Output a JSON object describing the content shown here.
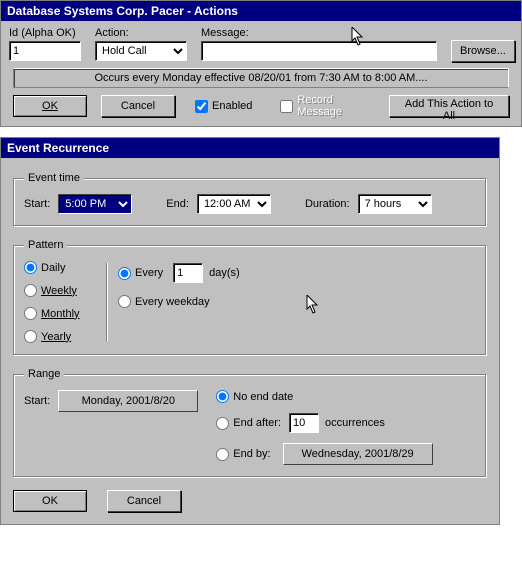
{
  "actions": {
    "title": "Database Systems Corp. Pacer - Actions",
    "labels": {
      "id": "Id (Alpha OK)",
      "action": "Action:",
      "message": "Message:"
    },
    "id_value": "1",
    "action_options": [
      "Hold Call"
    ],
    "action_selected": "Hold Call",
    "message_value": "",
    "browse": "Browse...",
    "occurs": "Occurs every Monday effective 08/20/01 from 7:30 AM to 8:00 AM....",
    "ok": "OK",
    "cancel": "Cancel",
    "enabled_label": "Enabled",
    "enabled_checked": true,
    "record_label": "Record Message",
    "record_checked": false,
    "add_all": "Add This Action to All"
  },
  "recur": {
    "title": "Event Recurrence",
    "time_group": "Event time",
    "start_label": "Start:",
    "start_options": [
      "5:00 PM"
    ],
    "start_selected": "5:00 PM",
    "end_label": "End:",
    "end_options": [
      "12:00 AM"
    ],
    "end_selected": "12:00 AM",
    "duration_label": "Duration:",
    "duration_options": [
      "7 hours"
    ],
    "duration_selected": "7 hours",
    "pattern_group": "Pattern",
    "pattern_mode": "daily",
    "daily": "Daily",
    "weekly": "Weekly",
    "monthly": "Monthly",
    "yearly": "Yearly",
    "daily_every_selected": true,
    "every_label_prefix": "Every",
    "every_n": "1",
    "every_label_suffix": "day(s)",
    "every_weekday_label": "Every weekday",
    "range_group": "Range",
    "range_start_label": "Start:",
    "range_start_value": "Monday, 2001/8/20",
    "range_mode": "noend",
    "noend_label": "No end date",
    "endafter_label": "End after:",
    "endafter_n": "10",
    "occurrences_label": "occurrences",
    "endby_label": "End by:",
    "endby_value": "Wednesday, 2001/8/29",
    "ok": "OK",
    "cancel": "Cancel"
  }
}
